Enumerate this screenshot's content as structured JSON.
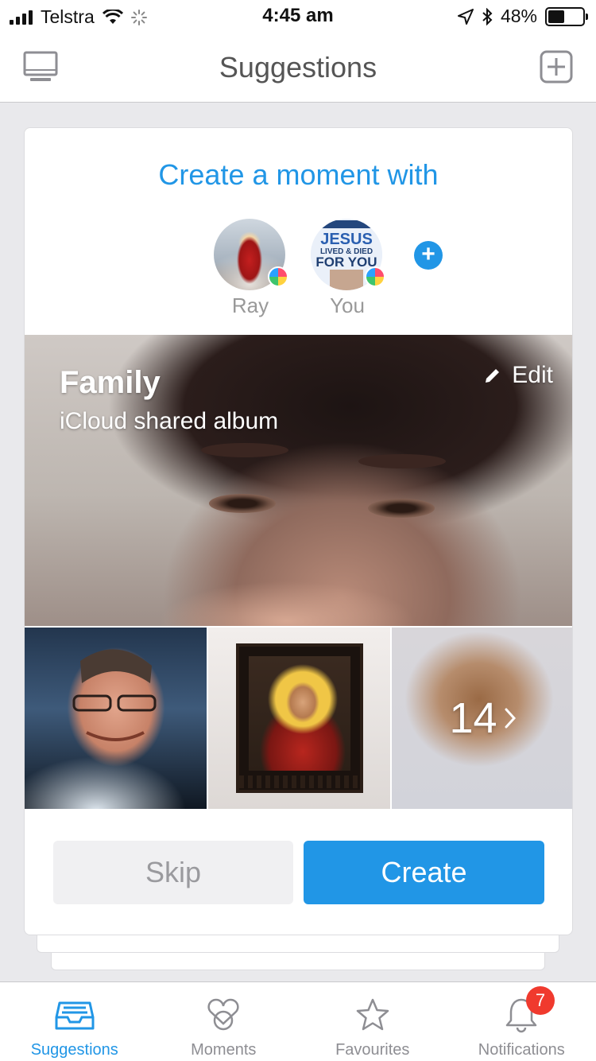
{
  "status_bar": {
    "carrier": "Telstra",
    "time": "4:45 am",
    "battery": "48%",
    "battery_level": 0.48
  },
  "nav": {
    "title": "Suggestions",
    "left_icon": "monitor-icon",
    "right_icon": "add-square-icon"
  },
  "card": {
    "heading": "Create a moment with",
    "people": [
      {
        "name": "Ray"
      },
      {
        "name": "You",
        "avatar_text": [
          "JESUS",
          "LIVED & DIED",
          "FOR YOU"
        ]
      }
    ],
    "add_icon": "+",
    "album": {
      "title": "Family",
      "subtitle": "iCloud shared album",
      "edit_label": "Edit"
    },
    "more_count": "14",
    "skip_label": "Skip",
    "create_label": "Create"
  },
  "tabs": [
    {
      "label": "Suggestions",
      "icon": "inbox-tray-icon",
      "active": true
    },
    {
      "label": "Moments",
      "icon": "hearts-icon",
      "active": false
    },
    {
      "label": "Favourites",
      "icon": "star-icon",
      "active": false
    },
    {
      "label": "Notifications",
      "icon": "bell-icon",
      "active": false,
      "badge": "7"
    }
  ],
  "colors": {
    "accent": "#2196e6",
    "badge": "#f03a2e"
  }
}
